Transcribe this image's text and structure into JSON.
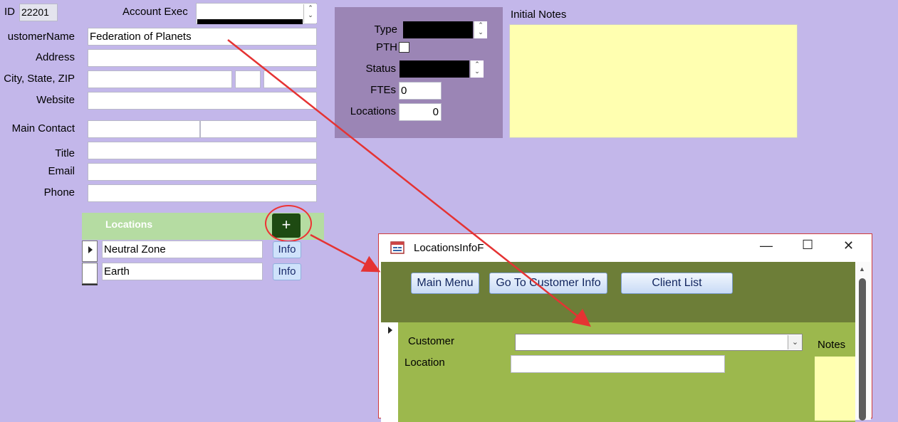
{
  "form": {
    "id_label": "ID",
    "id_value": "22201",
    "account_exec_label": "Account Exec",
    "customer_name_label": "ustomerName",
    "customer_name_value": "Federation of Planets",
    "address_label": "Address",
    "city_label": "City, State, ZIP",
    "website_label": "Website",
    "main_contact_label": "Main Contact",
    "title_label": "Title",
    "email_label": "Email",
    "phone_label": "Phone"
  },
  "panel": {
    "type_label": "Type",
    "pth_label": "PTH",
    "status_label": "Status",
    "ftes_label": "FTEs",
    "ftes_value": "0",
    "locations_label": "Locations",
    "locations_value": "0"
  },
  "notes": {
    "label": "Initial Notes"
  },
  "locations": {
    "title": "Locations",
    "add_label": "+",
    "rows": [
      {
        "name": "Neutral Zone",
        "info_label": "Info"
      },
      {
        "name": "Earth",
        "info_label": "Info"
      }
    ]
  },
  "popup": {
    "title": "LocationsInfoF",
    "minimize": "—",
    "maximize": "☐",
    "close": "✕",
    "main_menu_label": "Main Menu",
    "customer_info_label": "Go To Customer Info",
    "client_list_label": "Client List",
    "customer_label": "Customer",
    "location_label": "Location",
    "notes_label": "Notes"
  },
  "icons": {
    "spin": "spinner-icon",
    "record_selector": "record-selector-arrow-icon",
    "form_icon": "form-icon",
    "dropdown": "dropdown-arrow-icon"
  },
  "colors": {
    "background": "#c3b7ea",
    "annotation": "#e53333"
  }
}
